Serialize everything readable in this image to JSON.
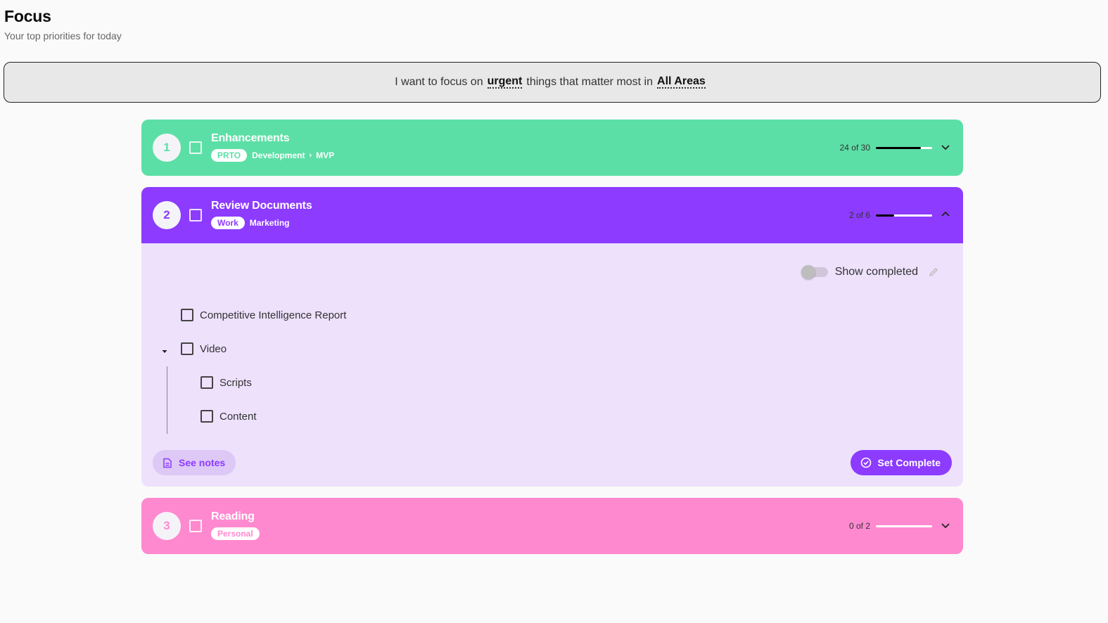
{
  "header": {
    "title": "Focus",
    "subtitle": "Your top priorities for today"
  },
  "focus_bar": {
    "prefix": "I want to focus on",
    "urgency": "urgent",
    "middle": "things that matter most in",
    "area": "All Areas"
  },
  "cards": [
    {
      "number": "1",
      "title": "Enhancements",
      "tag": "PRTO",
      "breadcrumb": [
        "Development",
        "MVP"
      ],
      "breadcrumb_sep": "›",
      "progress_text": "24 of 30",
      "progress": 0.8,
      "color": "#5cdfa6",
      "expanded": false
    },
    {
      "number": "2",
      "title": "Review Documents",
      "tag": "Work",
      "breadcrumb": [
        "Marketing"
      ],
      "progress_text": "2 of 6",
      "progress": 0.33,
      "color": "#8c3bff",
      "expanded": true,
      "body": {
        "show_completed_label": "Show completed",
        "show_completed": false,
        "tasks": [
          {
            "label": "Competitive Intelligence Report"
          },
          {
            "label": "Video"
          },
          {
            "label": "Scripts"
          },
          {
            "label": "Content"
          }
        ],
        "see_notes_label": "See notes",
        "set_complete_label": "Set Complete"
      }
    },
    {
      "number": "3",
      "title": "Reading",
      "tag": "Personal",
      "breadcrumb": [],
      "progress_text": "0 of 2",
      "progress": 0,
      "color": "#ff89cf",
      "expanded": false
    }
  ]
}
